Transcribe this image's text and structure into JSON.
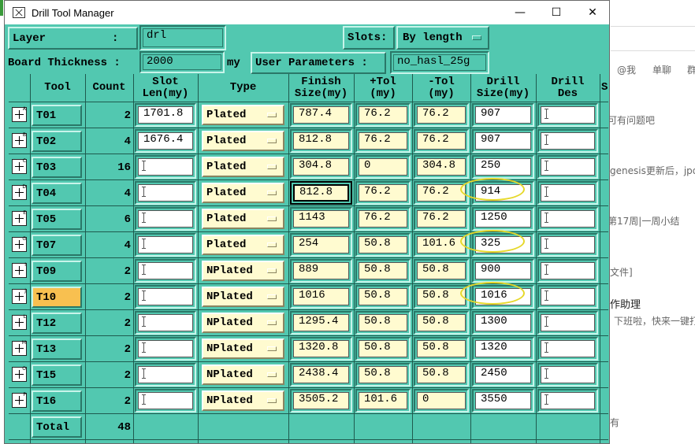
{
  "window": {
    "title": "Drill Tool Manager",
    "minimize": "—",
    "maximize": "☐",
    "close": "✕"
  },
  "header": {
    "layer_label": "Layer          :",
    "layer_value": "drl",
    "slots_label": "Slots:",
    "slots_value": "By length",
    "thickness_label": "Board Thickness :",
    "thickness_value": "2000",
    "thickness_unit": "my",
    "user_params_label": "User Parameters :",
    "user_params_value": "no_hasl_25g"
  },
  "columns": [
    "Tool",
    "Count",
    "Slot\nLen(my)",
    "Type",
    "Finish\nSize(my)",
    "+Tol\n(my)",
    "-Tol\n(my)",
    "Drill\nSize(my)",
    "Drill\nDes",
    "S"
  ],
  "rows": [
    {
      "tool": "T01",
      "sup": "A",
      "count": "2",
      "slot": "1701.8",
      "type": "Plated",
      "finish": "787.4",
      "ptol": "76.2",
      "mtol": "76.2",
      "drill": "907",
      "des": ""
    },
    {
      "tool": "T02",
      "sup": "B",
      "count": "4",
      "slot": "1676.4",
      "type": "Plated",
      "finish": "812.8",
      "ptol": "76.2",
      "mtol": "76.2",
      "drill": "907",
      "des": ""
    },
    {
      "tool": "T03",
      "sup": "C",
      "count": "16",
      "slot": "",
      "type": "Plated",
      "finish": "304.8",
      "ptol": "0",
      "mtol": "304.8",
      "drill": "250",
      "des": ""
    },
    {
      "tool": "T04",
      "sup": "D",
      "count": "4",
      "slot": "",
      "type": "Plated",
      "finish": "812.8",
      "ptol": "76.2",
      "mtol": "76.2",
      "drill": "914",
      "des": ""
    },
    {
      "tool": "T05",
      "sup": "E",
      "count": "6",
      "slot": "",
      "type": "Plated",
      "finish": "1143",
      "ptol": "76.2",
      "mtol": "76.2",
      "drill": "1250",
      "des": ""
    },
    {
      "tool": "T07",
      "sup": "G",
      "count": "4",
      "slot": "",
      "type": "Plated",
      "finish": "254",
      "ptol": "50.8",
      "mtol": "101.6",
      "drill": "325",
      "des": ""
    },
    {
      "tool": "T09",
      "sup": "I",
      "count": "2",
      "slot": "",
      "type": "NPlated",
      "finish": "889",
      "ptol": "50.8",
      "mtol": "50.8",
      "drill": "900",
      "des": ""
    },
    {
      "tool": "T10",
      "sup": "J",
      "count": "2",
      "slot": "",
      "type": "NPlated",
      "finish": "1016",
      "ptol": "50.8",
      "mtol": "50.8",
      "drill": "1016",
      "des": ""
    },
    {
      "tool": "T12",
      "sup": "L",
      "count": "2",
      "slot": "",
      "type": "NPlated",
      "finish": "1295.4",
      "ptol": "50.8",
      "mtol": "50.8",
      "drill": "1300",
      "des": ""
    },
    {
      "tool": "T13",
      "sup": "M",
      "count": "2",
      "slot": "",
      "type": "NPlated",
      "finish": "1320.8",
      "ptol": "50.8",
      "mtol": "50.8",
      "drill": "1320",
      "des": ""
    },
    {
      "tool": "T15",
      "sup": "O",
      "count": "2",
      "slot": "",
      "type": "NPlated",
      "finish": "2438.4",
      "ptol": "50.8",
      "mtol": "50.8",
      "drill": "2450",
      "des": ""
    },
    {
      "tool": "T16",
      "sup": "P",
      "count": "2",
      "slot": "",
      "type": "NPlated",
      "finish": "3505.2",
      "ptol": "101.6",
      "mtol": "0",
      "drill": "3550",
      "des": ""
    }
  ],
  "footer": {
    "total_label": "Total",
    "total_count": "48"
  },
  "background_app": {
    "items": [
      "@我",
      "单聊",
      "群",
      "可有问题吧",
      "genesis更新后，jpq",
      "第17周|一周小结",
      "文件]",
      "作助理",
      "下班啦，快来一键打",
      "有"
    ]
  }
}
